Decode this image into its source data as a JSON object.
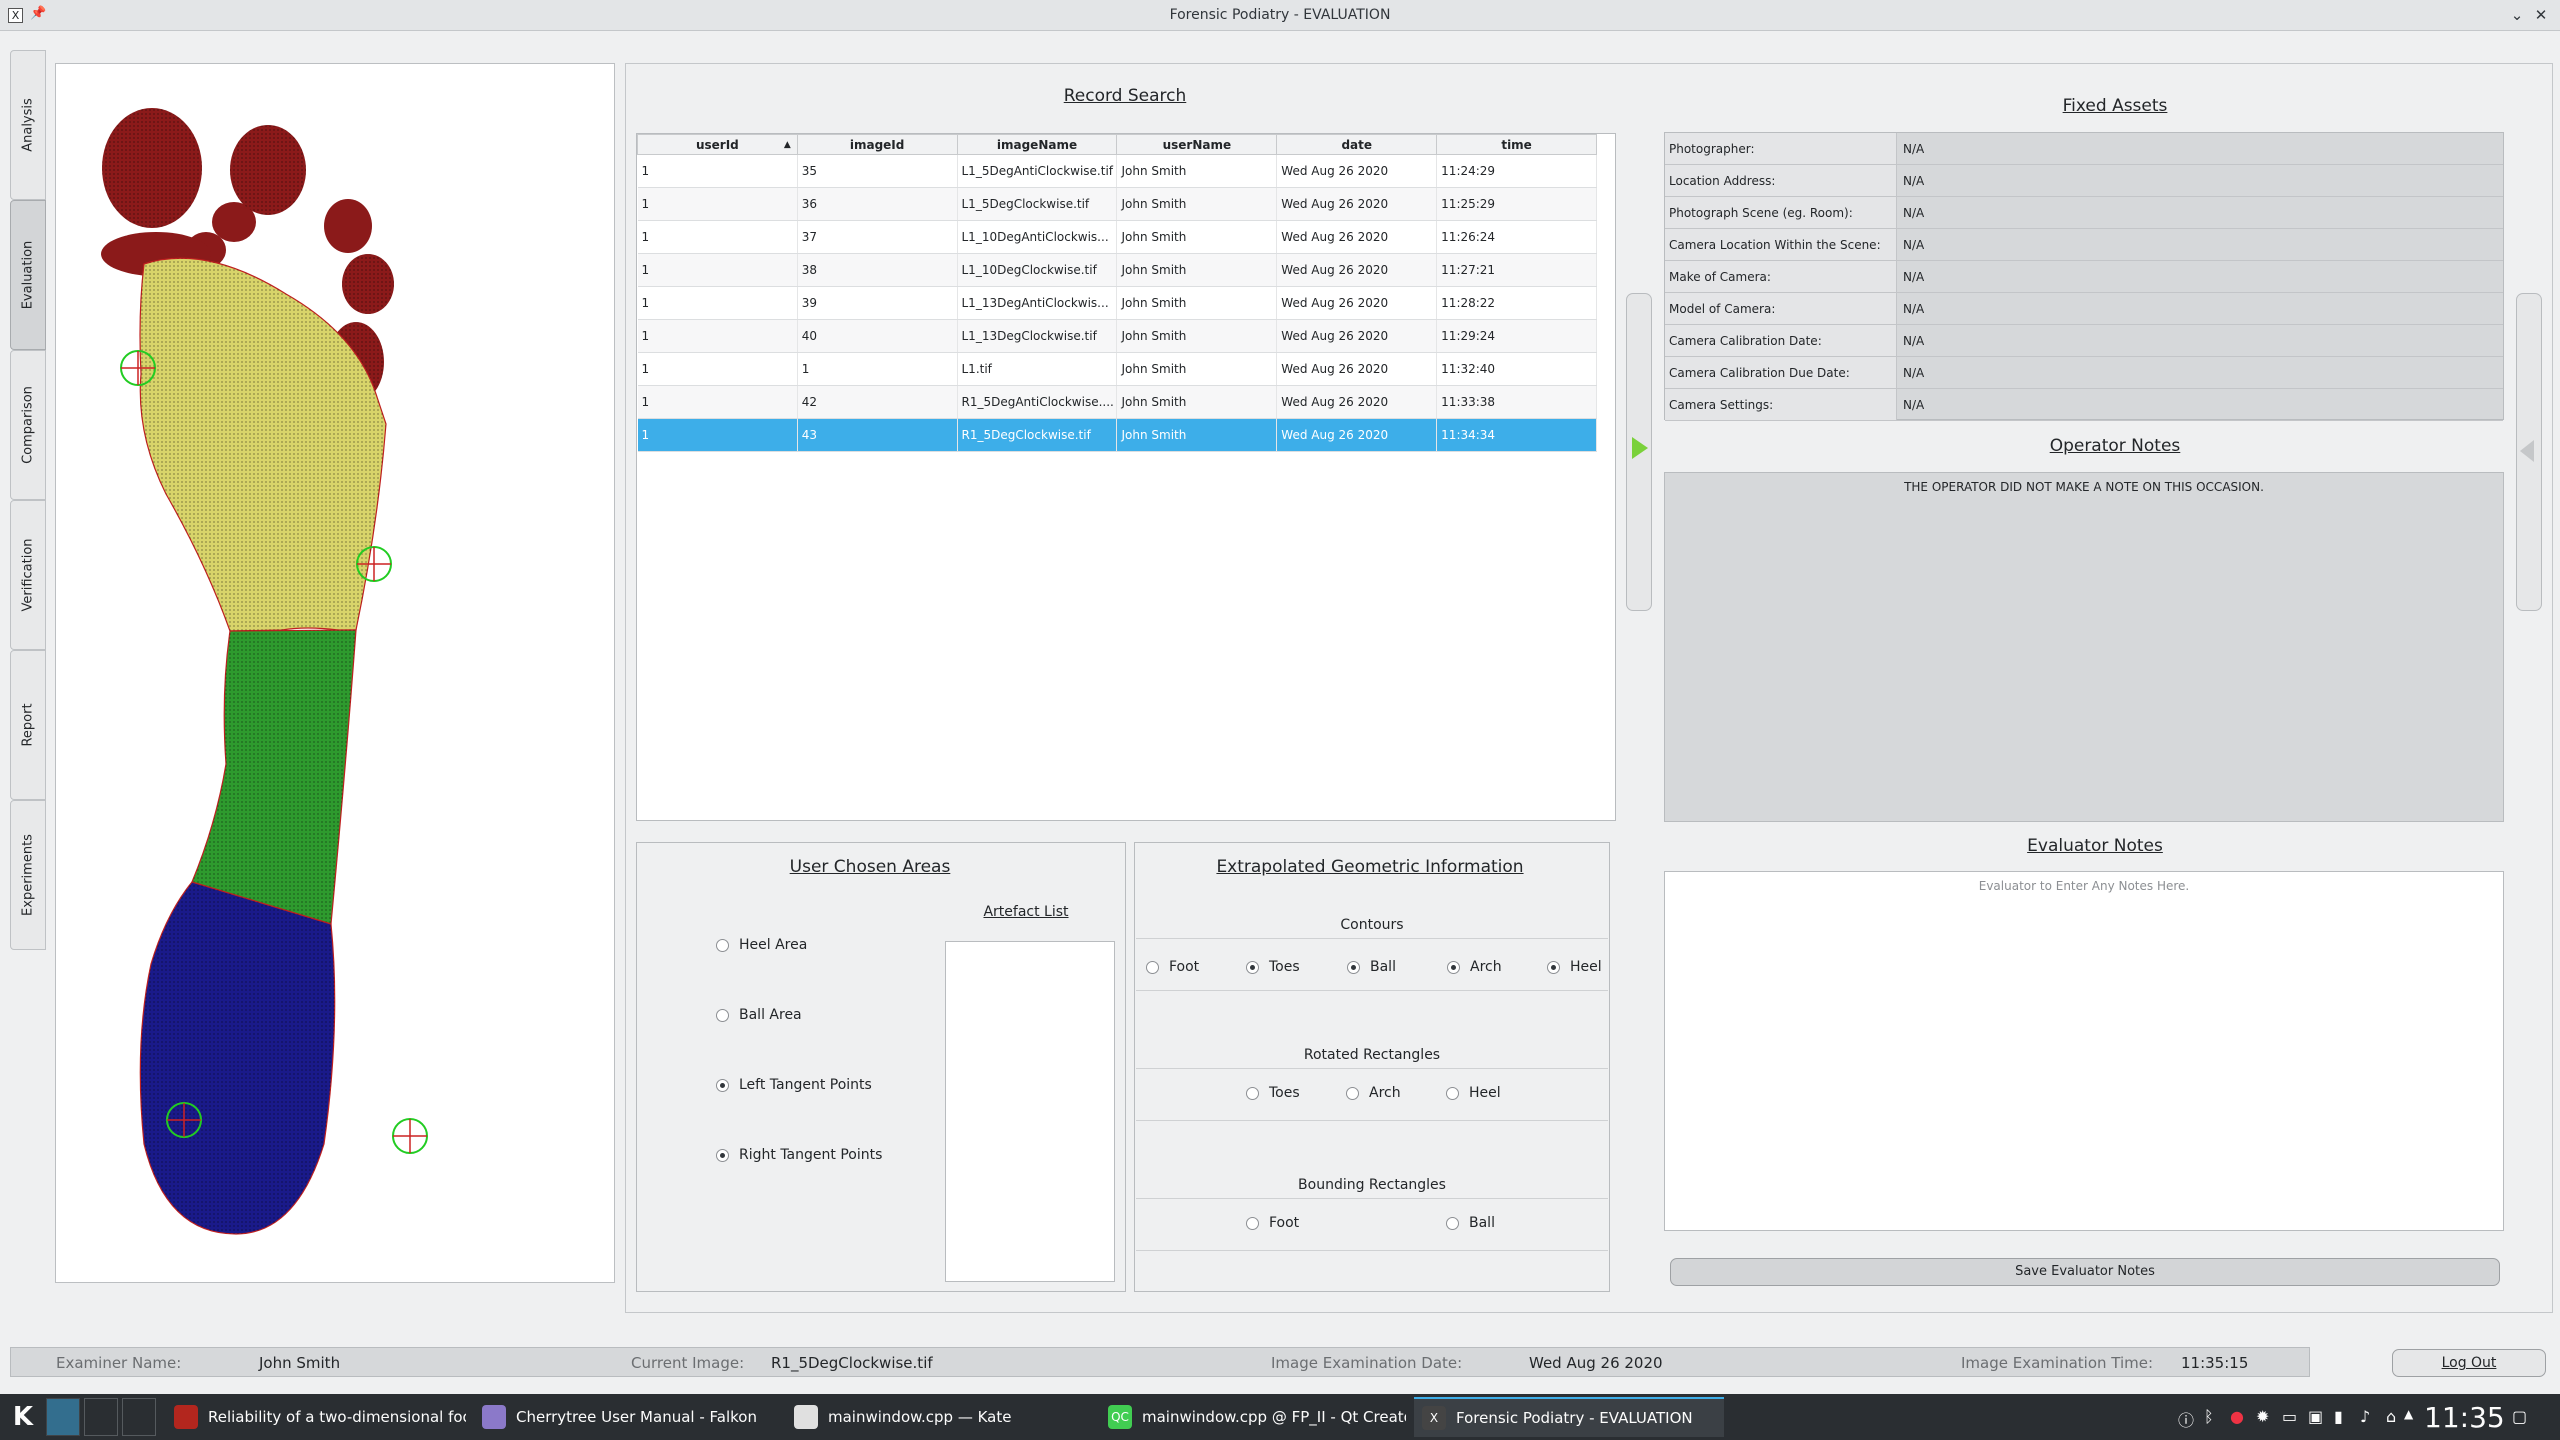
{
  "window": {
    "title": "Forensic Podiatry - EVALUATION",
    "app_icon": "X",
    "pin_icon": "pin-icon",
    "controls": [
      "⌄",
      "✕"
    ]
  },
  "tabs": [
    "Analysis",
    "Evaluation",
    "Comparison",
    "Verification",
    "Report",
    "Experiments"
  ],
  "active_tab": "Evaluation",
  "record_search": {
    "title": "Record Search",
    "columns": [
      "userId",
      "imageId",
      "imageName",
      "userName",
      "date",
      "time"
    ],
    "rows": [
      [
        "1",
        "35",
        "L1_5DegAntiClockwise.tif",
        "John Smith",
        "Wed Aug 26 2020",
        "11:24:29"
      ],
      [
        "1",
        "36",
        "L1_5DegClockwise.tif",
        "John Smith",
        "Wed Aug 26 2020",
        "11:25:29"
      ],
      [
        "1",
        "37",
        "L1_10DegAntiClockwis...",
        "John Smith",
        "Wed Aug 26 2020",
        "11:26:24"
      ],
      [
        "1",
        "38",
        "L1_10DegClockwise.tif",
        "John Smith",
        "Wed Aug 26 2020",
        "11:27:21"
      ],
      [
        "1",
        "39",
        "L1_13DegAntiClockwis...",
        "John Smith",
        "Wed Aug 26 2020",
        "11:28:22"
      ],
      [
        "1",
        "40",
        "L1_13DegClockwise.tif",
        "John Smith",
        "Wed Aug 26 2020",
        "11:29:24"
      ],
      [
        "1",
        "1",
        "L1.tif",
        "John Smith",
        "Wed Aug 26 2020",
        "11:32:40"
      ],
      [
        "1",
        "42",
        "R1_5DegAntiClockwise....",
        "John Smith",
        "Wed Aug 26 2020",
        "11:33:38"
      ],
      [
        "1",
        "43",
        "R1_5DegClockwise.tif",
        "John Smith",
        "Wed Aug 26 2020",
        "11:34:34"
      ]
    ],
    "selected_row": 8
  },
  "user_areas": {
    "title": "User Chosen Areas",
    "artefact_title": "Artefact List",
    "options": [
      {
        "label": "Heel Area",
        "checked": false
      },
      {
        "label": "Ball Area",
        "checked": false
      },
      {
        "label": "Left Tangent Points",
        "checked": true
      },
      {
        "label": "Right Tangent Points",
        "checked": true
      }
    ]
  },
  "geometric": {
    "title": "Extrapolated Geometric Information",
    "contours_label": "Contours",
    "contours": [
      {
        "label": "Foot",
        "checked": false
      },
      {
        "label": "Toes",
        "checked": true
      },
      {
        "label": "Ball",
        "checked": true
      },
      {
        "label": "Arch",
        "checked": true
      },
      {
        "label": "Heel",
        "checked": true
      }
    ],
    "rotated_label": "Rotated Rectangles",
    "rotated": [
      {
        "label": "Toes",
        "checked": false
      },
      {
        "label": "Arch",
        "checked": false
      },
      {
        "label": "Heel",
        "checked": false
      }
    ],
    "bounding_label": "Bounding Rectangles",
    "bounding": [
      {
        "label": "Foot",
        "checked": false
      },
      {
        "label": "Ball",
        "checked": false
      }
    ]
  },
  "fixed_assets": {
    "title": "Fixed Assets",
    "rows": [
      [
        "Photographer:",
        "N/A"
      ],
      [
        "Location Address:",
        "N/A"
      ],
      [
        "Photograph Scene (eg. Room):",
        "N/A"
      ],
      [
        "Camera Location Within the Scene:",
        "N/A"
      ],
      [
        "Make of Camera:",
        "N/A"
      ],
      [
        "Model of Camera:",
        "N/A"
      ],
      [
        "Camera Calibration Date:",
        "N/A"
      ],
      [
        "Camera Calibration Due Date:",
        "N/A"
      ],
      [
        "Camera Settings:",
        "N/A"
      ]
    ]
  },
  "operator_notes": {
    "title": "Operator Notes",
    "text": "THE OPERATOR DID NOT MAKE A NOTE ON THIS OCCASION."
  },
  "evaluator_notes": {
    "title": "Evaluator Notes",
    "placeholder": "Evaluator to Enter Any Notes Here.",
    "save_label": "Save Evaluator Notes"
  },
  "status": {
    "examiner_label": "Examiner Name:",
    "examiner": "John Smith",
    "image_label": "Current Image:",
    "image": "R1_5DegClockwise.tif",
    "date_label": "Image Examination Date:",
    "date": "Wed Aug 26 2020",
    "time_label": "Image Examination Time:",
    "time": "11:35:15",
    "logout_label": "Log Out"
  },
  "taskbar": {
    "start_icon": "K",
    "tasks": [
      {
        "label": "Reliability of a two-dimensional foot...",
        "icon": "acrobat-icon",
        "icon_glyph": "",
        "color": "#b3261e"
      },
      {
        "label": "Cherrytree User Manual - Falkon",
        "icon": "falkon-icon",
        "icon_glyph": "",
        "color": "#8b79c9"
      },
      {
        "label": "mainwindow.cpp — Kate",
        "icon": "kate-icon",
        "icon_glyph": "",
        "color": "#e0e0e0"
      },
      {
        "label": "mainwindow.cpp @ FP_II - Qt Creator",
        "icon": "qtcreator-icon",
        "icon_glyph": "QC",
        "color": "#41cd52"
      },
      {
        "label": "Forensic Podiatry - EVALUATION",
        "icon": "x-app-icon",
        "icon_glyph": "X",
        "color": "#444"
      }
    ],
    "active_task": 4,
    "clock": "11:35"
  },
  "colors": {
    "accent": "#3daee9",
    "toes": "#8b1a1a",
    "ball": "#d8d46a",
    "arch": "#2e9a2e",
    "heel": "#1a1a8a"
  }
}
